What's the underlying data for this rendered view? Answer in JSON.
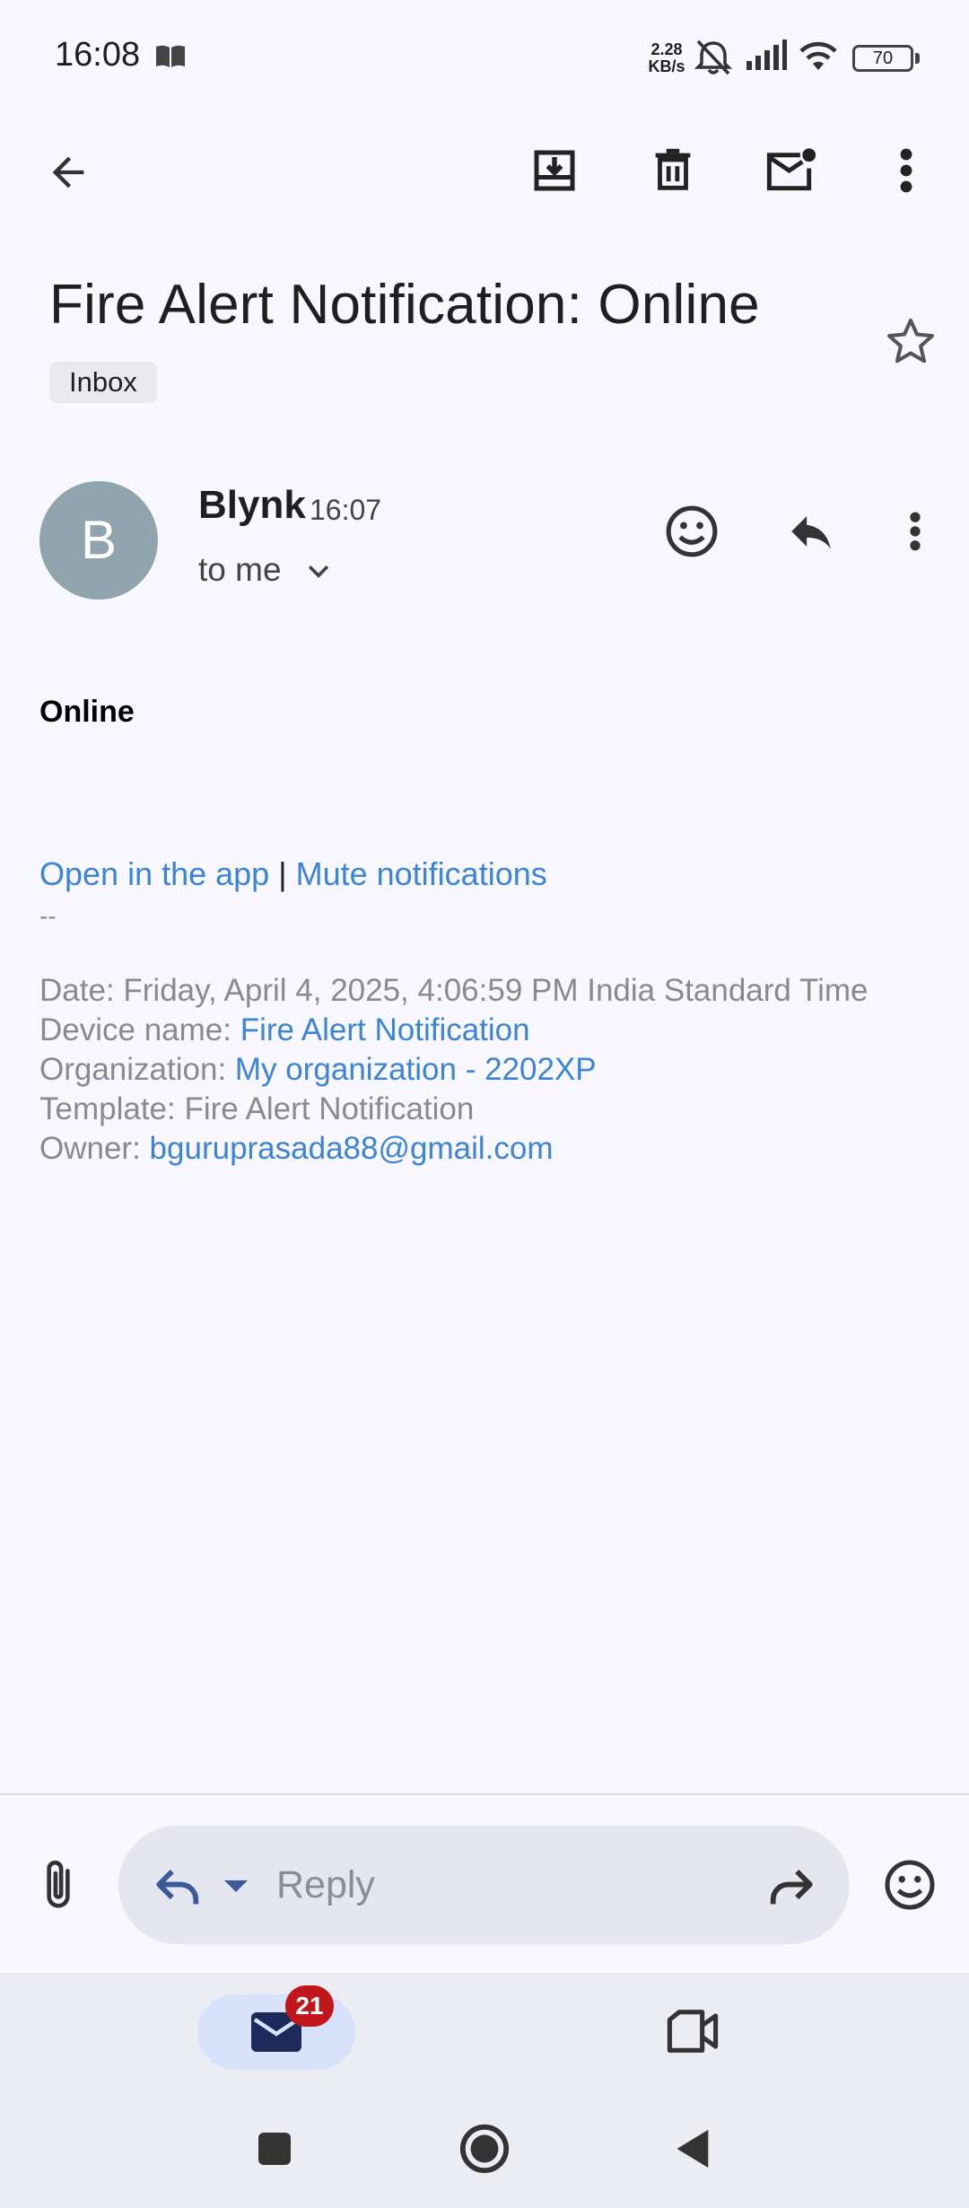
{
  "status_bar": {
    "time": "16:08",
    "net_speed_value": "2.28",
    "net_speed_unit": "KB/s",
    "battery": "70",
    "icons": [
      "book-icon",
      "muted-bell-icon",
      "signal-icon",
      "wifi-icon",
      "battery-icon"
    ]
  },
  "toolbar": {
    "icons": [
      "back-arrow-icon",
      "archive-icon",
      "delete-icon",
      "mark-unread-icon",
      "more-vert-icon"
    ]
  },
  "email": {
    "subject": "Fire Alert Notification: Online",
    "label": "Inbox",
    "sender": {
      "initial": "B",
      "avatar_color": "#90a4ae",
      "name": "Blynk",
      "time": "16:07",
      "recipient": "to me"
    },
    "body": {
      "heading": "Online",
      "link_open": "Open in the app",
      "separator": "|",
      "link_mute": "Mute notifications",
      "signature_sep": "--",
      "date_label": "Date: Friday, April 4, 2025, 4:06:59 PM India Standard Time",
      "device_label": "Device name: ",
      "device_value": "Fire Alert Notification",
      "org_label": "Organization: ",
      "org_value": "My organization - 2202XP",
      "template_label": "Template: Fire Alert Notification",
      "owner_label": "Owner: ",
      "owner_value": "bguruprasada88@gmail.com"
    }
  },
  "reply_bar": {
    "placeholder": "Reply"
  },
  "bottom_nav": {
    "mail_badge": "21"
  },
  "colors": {
    "link": "#3c84d6",
    "badge": "#c0161c",
    "background": "#f8f7fd"
  }
}
